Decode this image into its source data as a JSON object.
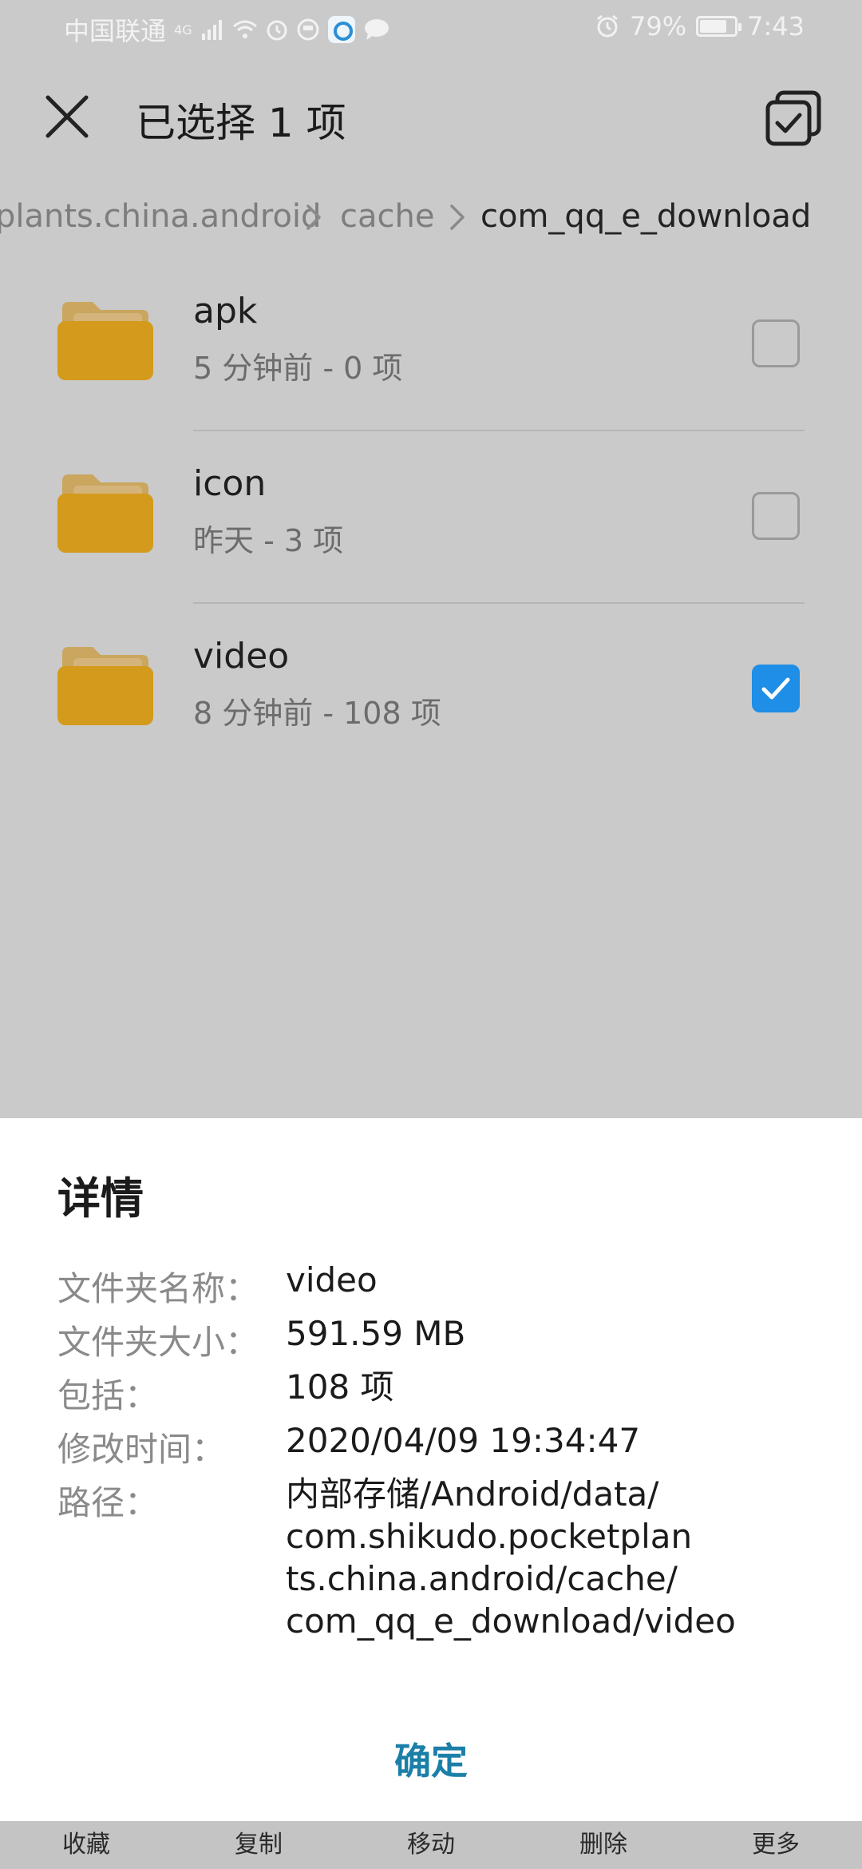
{
  "status_bar": {
    "carrier": "中国联通",
    "network": "4G",
    "battery": "79%",
    "battery_level": 0.79,
    "time": "7:43"
  },
  "title_bar": {
    "title": "已选择 1 项",
    "close_icon": "close-icon",
    "select_all_icon": "select-all-icon"
  },
  "breadcrumb": {
    "items": [
      "plants.china.android",
      "cache",
      "com_qq_e_download"
    ]
  },
  "files": [
    {
      "name": "apk",
      "meta": "5 分钟前 - 0 项",
      "checked": false
    },
    {
      "name": "icon",
      "meta": "昨天 - 3 项",
      "checked": false
    },
    {
      "name": "video",
      "meta": "8 分钟前 - 108 项",
      "checked": true
    }
  ],
  "details": {
    "title": "详情",
    "rows": [
      {
        "label": "文件夹名称：",
        "value": "video"
      },
      {
        "label": "文件夹大小：",
        "value": "591.59 MB"
      },
      {
        "label": "包括：",
        "value": "108 项"
      },
      {
        "label": "修改时间：",
        "value": "2020/04/09 19:34:47"
      },
      {
        "label": "路径：",
        "value_lines": [
          "内部存储/Android/data/",
          "com.shikudo.pocketplan",
          "ts.china.android/cache/",
          "com_qq_e_download/video"
        ]
      }
    ],
    "confirm_label": "确定"
  },
  "actions": [
    "收藏",
    "复制",
    "移动",
    "删除",
    "更多"
  ],
  "colors": {
    "accent": "#1f8ee6",
    "folder": "#d39a1c",
    "confirm": "#1b7fa8",
    "overlay": "#cacaca"
  }
}
